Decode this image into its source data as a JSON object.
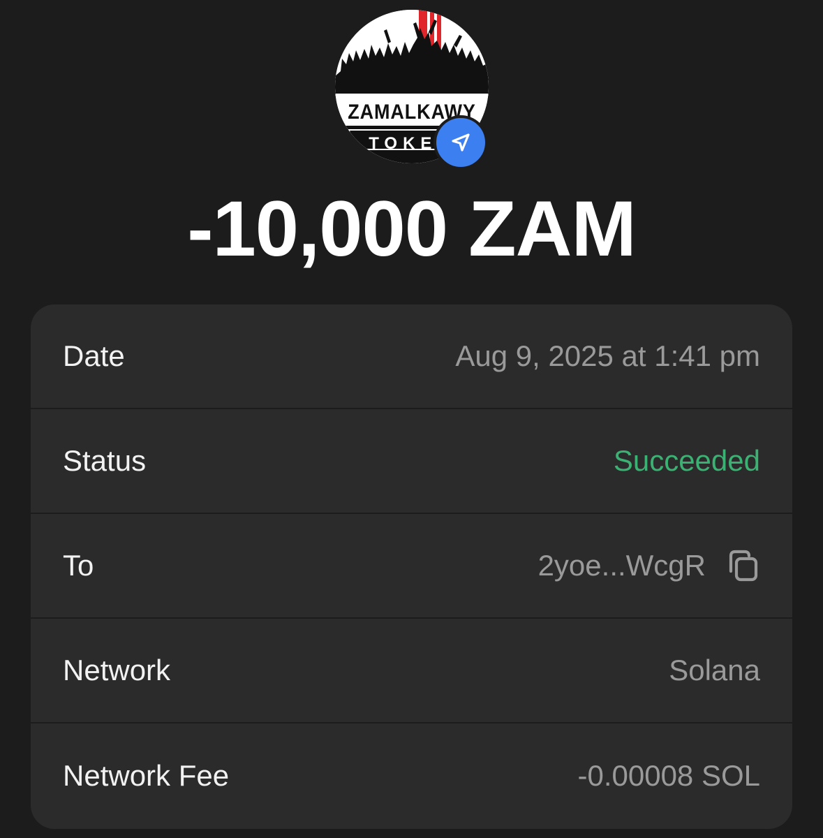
{
  "token": {
    "logo_text_top": "ZAMALKAWY",
    "logo_text_bottom": "TOKEN",
    "logo_icon": "crowd-silhouette-logo",
    "badge_icon": "send-arrow-icon",
    "badge_color": "#3c7ff0"
  },
  "amount": "-10,000 ZAM",
  "details": {
    "date_label": "Date",
    "date_value": "Aug 9, 2025 at 1:41 pm",
    "status_label": "Status",
    "status_value": "Succeeded",
    "status_color": "#3bb273",
    "to_label": "To",
    "to_value": "2yoe...WcgR",
    "to_icon": "copy-icon",
    "network_label": "Network",
    "network_value": "Solana",
    "fee_label": "Network Fee",
    "fee_value": "-0.00008 SOL"
  }
}
